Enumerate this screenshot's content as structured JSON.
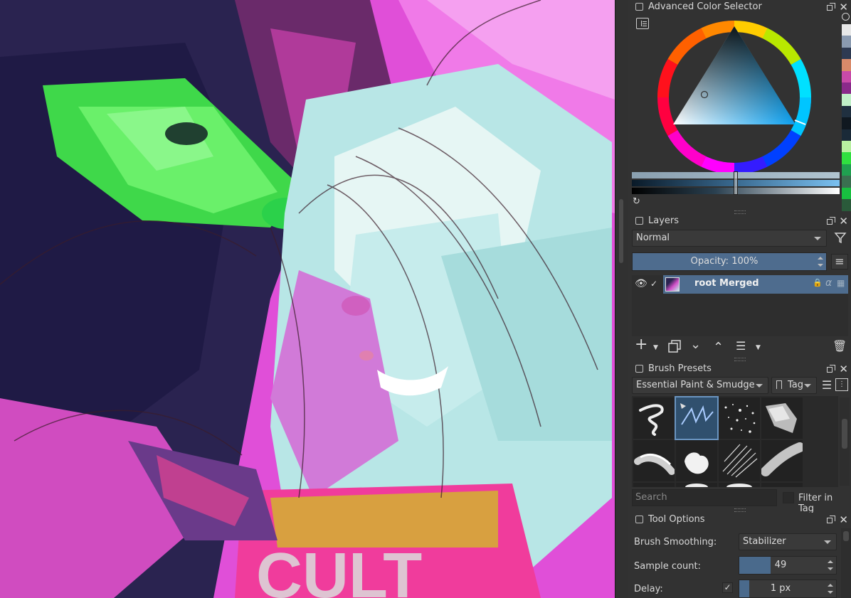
{
  "color_selector": {
    "title": "Advanced Color Selector",
    "swatches": [
      "#e8e8e8",
      "#8a9ab0",
      "#2e3a52",
      "#d98a6a",
      "#c84aa8",
      "#8a2a8a",
      "#c0f0c8",
      "#203040",
      "#101820",
      "#1a2a38",
      "#b8f0a0",
      "#30e040",
      "#20a050",
      "#3a7050",
      "#18c040",
      "#2a5a3a"
    ]
  },
  "layers": {
    "title": "Layers",
    "blend_mode": "Normal",
    "opacity_label": "Opacity:  100%",
    "layer_name": "root Merged",
    "alpha_symbol": "α"
  },
  "brush_presets": {
    "title": "Brush Presets",
    "category": "Essential Paint & Smudge",
    "tag_label": "Tag",
    "search_placeholder": "Search",
    "filter_label": "Filter in Tag"
  },
  "tool_options": {
    "title": "Tool Options",
    "smoothing_label": "Brush Smoothing:",
    "smoothing_value": "Stabilizer",
    "sample_label": "Sample count:",
    "sample_value": "49",
    "delay_label": "Delay:",
    "delay_value": "1 px"
  },
  "colors": {
    "accent": "#4a6a8c",
    "panel": "#323232",
    "selection": "#4e6c8e"
  }
}
